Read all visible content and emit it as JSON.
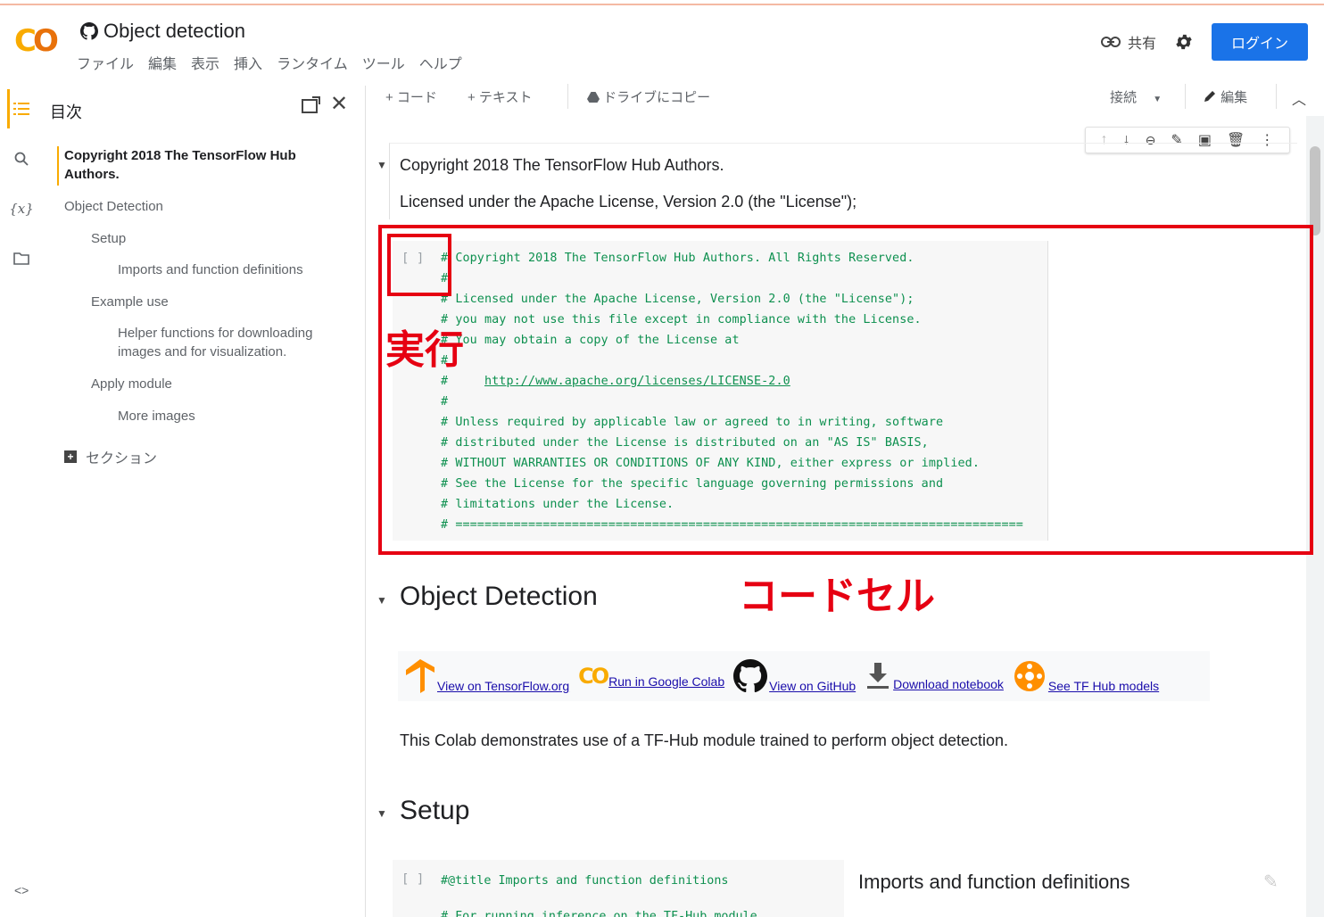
{
  "app": {
    "logo": "CO",
    "notebook_title": "Object detection",
    "menu": [
      "ファイル",
      "編集",
      "表示",
      "挿入",
      "ランタイム",
      "ツール",
      "ヘルプ"
    ],
    "share_label": "共有",
    "login_label": "ログイン"
  },
  "toc": {
    "title": "目次",
    "items": [
      "Copyright 2018 The TensorFlow Hub Authors.",
      "Object Detection",
      "Setup",
      "Imports and function definitions",
      "Example use",
      "Helper functions for downloading images and for visualization.",
      "Apply module",
      "More images"
    ],
    "section_label": "セクション"
  },
  "toolbar": {
    "add_code": "+ コード",
    "add_text": "+ テキスト",
    "copy_drive": "ドライブにコピー",
    "connect": "接続",
    "edit": "編集"
  },
  "cell_text_1": {
    "line1": "Copyright 2018 The TensorFlow Hub Authors.",
    "line2": "Licensed under the Apache License, Version 2.0 (the \"License\");"
  },
  "code_cell": {
    "run_bracket": "[ ]",
    "lines": [
      "# Copyright 2018 The TensorFlow Hub Authors. All Rights Reserved.",
      "#",
      "# Licensed under the Apache License, Version 2.0 (the \"License\");",
      "# you may not use this file except in compliance with the License.",
      "# You may obtain a copy of the License at",
      "#",
      "#     ",
      "#",
      "# Unless required by applicable law or agreed to in writing, software",
      "# distributed under the License is distributed on an \"AS IS\" BASIS,",
      "# WITHOUT WARRANTIES OR CONDITIONS OF ANY KIND, either express or implied.",
      "# See the License for the specific language governing permissions and",
      "# limitations under the License.",
      "# =============================================================================="
    ],
    "license_link": "http://www.apache.org/licenses/LICENSE-2.0"
  },
  "annotations": {
    "run": "実行",
    "code_cell": "コードセル"
  },
  "section_object_detection": {
    "heading": "Object Detection",
    "badges": [
      "View on TensorFlow.org",
      "Run in Google Colab",
      "View on GitHub",
      "Download notebook",
      "See TF Hub models"
    ],
    "description": "This Colab demonstrates use of a TF-Hub module trained to perform object detection."
  },
  "section_setup": {
    "heading": "Setup",
    "run_bracket": "[ ]",
    "code": "#@title Imports and function definitions",
    "code2": "# For running inference on the TF-Hub module.",
    "form_title": "Imports and function definitions"
  },
  "colors": {
    "accent_orange": "#f9ab00",
    "login_blue": "#1a73e8",
    "annotation_red": "#e60012",
    "code_green": "#0d904f"
  }
}
